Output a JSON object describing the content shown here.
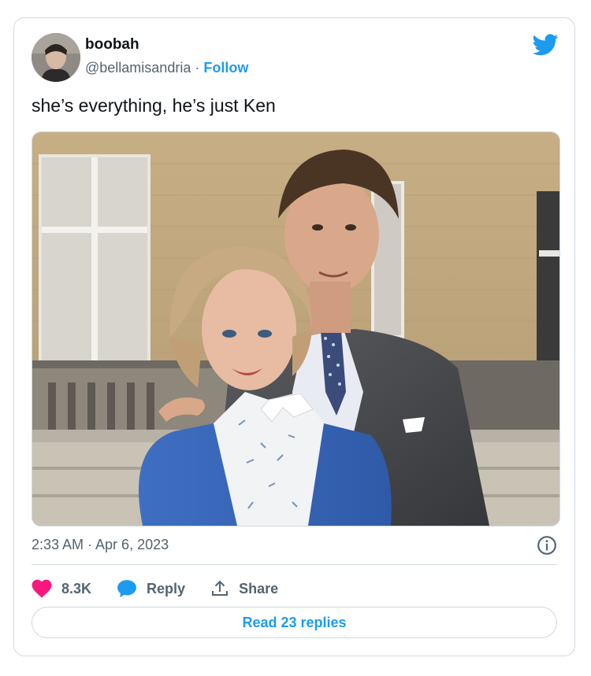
{
  "tweet": {
    "display_name": "boobah",
    "handle": "@bellamisandria",
    "separator": "·",
    "follow_label": "Follow",
    "text": "she’s everything, he’s just Ken",
    "timestamp": "2:33 AM · Apr 6, 2023",
    "likes": "8.3K",
    "reply_label": "Reply",
    "share_label": "Share",
    "read_replies_label": "Read 23 replies"
  },
  "colors": {
    "accent": "#1d9bf0",
    "like": "#f91880",
    "muted": "#536471",
    "border": "#cfd9de"
  },
  "icons": {
    "brand": "twitter-bird-icon",
    "info": "info-icon",
    "like": "heart-icon",
    "reply": "speech-bubble-icon",
    "share": "share-upload-icon"
  }
}
